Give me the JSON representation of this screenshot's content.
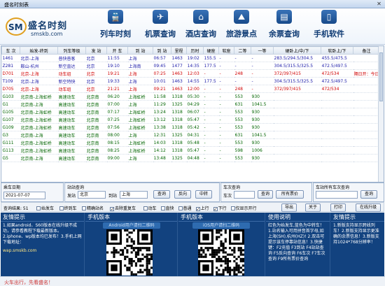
{
  "window": {
    "title": "盛名时刻表",
    "close_glyph": "✕"
  },
  "logo": {
    "mark": "SM",
    "name": "盛名时刻",
    "url": "smskb.com"
  },
  "nav": [
    {
      "label": "列车时刻",
      "icon": "train-icon",
      "glyph": "🚆"
    },
    {
      "label": "机票查询",
      "icon": "plane-icon",
      "glyph": "✈"
    },
    {
      "label": "酒店查询",
      "icon": "hotel-icon",
      "glyph": "⌂"
    },
    {
      "label": "旅游景点",
      "icon": "scenery-icon",
      "glyph": "⛰"
    },
    {
      "label": "余票查询",
      "icon": "ticket-icon",
      "glyph": "▤"
    },
    {
      "label": "手机软件",
      "icon": "phone-icon",
      "glyph": "▯"
    }
  ],
  "table": {
    "headers": [
      "车 次",
      "始发-终到",
      "列车等级",
      "发 站",
      "开 车",
      "到 站",
      "到 站",
      "里程",
      "历时",
      "硬座",
      "软座",
      "二等",
      "一等",
      "硬卧上/中/下",
      "软卧上/下",
      "备注"
    ],
    "rows": [
      {
        "style": "blue",
        "cells": [
          "1461",
          "北京-上海",
          "普快普客",
          "北京",
          "11:55",
          "上海",
          "06:57",
          "1463",
          "19:02",
          "155.5",
          "-",
          "-",
          "-",
          "283.5/294.5/304.5",
          "455.5/475.5",
          ""
        ]
      },
      {
        "style": "blue",
        "cells": [
          "Z281",
          "鞍山-杭州",
          "新空直达",
          "北京",
          "19:10",
          "上海南",
          "09:45",
          "1477",
          "14:35",
          "177.5",
          "-",
          "-",
          "-",
          "304.5/315.5/325.5",
          "472.5/497.5",
          ""
        ]
      },
      {
        "style": "red",
        "cells": [
          "D701",
          "北京-上海",
          "动车组",
          "北京",
          "19:21",
          "上海",
          "07:25",
          "1463",
          "12:03",
          "-",
          "-",
          "248",
          "-",
          "372/397/415",
          "472/534",
          "隔日开：今日开"
        ]
      },
      {
        "style": "blue",
        "cells": [
          "T109",
          "北京-上海",
          "新空特快",
          "北京",
          "19:33",
          "上海",
          "10:01",
          "1463",
          "14:55",
          "177.5",
          "-",
          "-",
          "-",
          "304.5/315.5/325.5",
          "472.5/497.5",
          ""
        ]
      },
      {
        "style": "red",
        "cells": [
          "D705",
          "北京-上海",
          "动车组",
          "北京",
          "21:21",
          "上海",
          "09:21",
          "1463",
          "12:00",
          "-",
          "-",
          "248",
          "-",
          "372/397/415",
          "472/534",
          ""
        ]
      },
      {
        "style": "green",
        "cells": [
          "G103",
          "北京南-上海虹桥",
          "高速动车",
          "北京南",
          "06:20",
          "上海虹桥",
          "11:58",
          "1318",
          "05:30",
          "-",
          "-",
          "553",
          "930",
          "",
          "",
          ""
        ]
      },
      {
        "style": "green",
        "cells": [
          "G1",
          "北京南-上海",
          "高速动车",
          "北京南",
          "07:00",
          "上海",
          "11:29",
          "1325",
          "04:29",
          "-",
          "-",
          "631",
          "1041.5",
          "",
          "",
          ""
        ]
      },
      {
        "style": "green",
        "cells": [
          "G105",
          "北京南-上海虹桥",
          "高速动车",
          "北京南",
          "07:17",
          "上海虹桥",
          "13:24",
          "1318",
          "06:07",
          "-",
          "-",
          "553",
          "930",
          "",
          "",
          ""
        ]
      },
      {
        "style": "green",
        "cells": [
          "G107",
          "北京南-上海虹桥",
          "高速动车",
          "北京南",
          "07:25",
          "上海虹桥",
          "13:12",
          "1318",
          "05:47",
          "-",
          "-",
          "553",
          "930",
          "",
          "",
          ""
        ]
      },
      {
        "style": "green",
        "cells": [
          "G109",
          "北京南-上海虹桥",
          "高速动车",
          "北京南",
          "07:56",
          "上海虹桥",
          "13:38",
          "1318",
          "05:42",
          "-",
          "-",
          "553",
          "930",
          "",
          "",
          ""
        ]
      },
      {
        "style": "green",
        "cells": [
          "G3",
          "北京南-上海",
          "高速动车",
          "北京南",
          "08:00",
          "上海",
          "12:31",
          "1325",
          "04:31",
          "-",
          "-",
          "631",
          "1041.5",
          "",
          "",
          ""
        ]
      },
      {
        "style": "green",
        "cells": [
          "G111",
          "北京南-上海虹桥",
          "高速动车",
          "北京南",
          "08:15",
          "上海虹桥",
          "14:03",
          "1318",
          "05:48",
          "-",
          "-",
          "553",
          "930",
          "",
          "",
          ""
        ]
      },
      {
        "style": "green",
        "cells": [
          "G113",
          "北京南-上海虹桥",
          "高速动车",
          "北京南",
          "08:25",
          "上海虹桥",
          "14:12",
          "1318",
          "05:47",
          "-",
          "-",
          "598",
          "1006",
          "",
          "",
          ""
        ]
      },
      {
        "style": "green",
        "cells": [
          "G5",
          "北京南-上海",
          "高速动车",
          "北京南",
          "09:00",
          "上海",
          "13:48",
          "1325",
          "04:48",
          "-",
          "-",
          "553",
          "930",
          "",
          "",
          ""
        ]
      }
    ]
  },
  "query": {
    "date_label": "乘车日期",
    "date_value": "2021-07-07",
    "station_label": "站站查询",
    "from_label": "发站",
    "from_value": "北京",
    "to_label": "到站",
    "to_value": "上海",
    "query_btn": "查询",
    "back_btn": "反向",
    "transfer_btn": "中转",
    "train_label": "车次查询",
    "train_prefix": "车次",
    "train_query_btn": "查询",
    "all_stops_btn": "所有票价",
    "station_all_label": "车站所有车次查询",
    "station_query_btn": "查询"
  },
  "options": {
    "result_label": "查询结果: 51",
    "items": [
      {
        "label": "始发车",
        "checked": false
      },
      {
        "label": "终到车",
        "checked": false
      },
      {
        "label": "精确站名",
        "checked": false
      },
      {
        "label": "去除重复车",
        "checked": true
      },
      {
        "label": "动车",
        "checked": false
      },
      {
        "label": "直快",
        "checked": false
      },
      {
        "label": "普通",
        "checked": false
      },
      {
        "label": "上行",
        "checked": true
      },
      {
        "label": "下行",
        "checked": true
      },
      {
        "label": "仅显示开行",
        "checked": false
      }
    ],
    "check_mark": "✓",
    "export_btn": "导出",
    "about_btn": "关于",
    "print_btn": "打印",
    "update_btn": "在线升级"
  },
  "bottom": {
    "tip_title": "友情提示",
    "tip_text": "1.如果android、S60版本在线升级不成功，请参看教程下载最新版本。2.iphone、wp版本均已发布！3.手机上网下载地址：",
    "tip_url": "wap.smskb.com",
    "android_title": "手机版本",
    "android_qr_label": "Android用户请扫二维码",
    "ios_title": "手机版本",
    "ios_qr_label": "iOS用户请扫二维码",
    "usage_title": "使用说明",
    "usage_text": "红色为始发车,蓝色为中转车！1.站名输入可用拼音首字母,如上海(SH),杭州(HZ)! 2.双击可提示该车停靠站信息！3.快捷键：F2充值 F3到站 F4站站查询 F5反向查询 F6车次 F7车次查询 F9所有票价查询",
    "tip2_title": "友情提示",
    "tip2_text": "1.新版支持显示跨线列车！2.新版支持显示更准确的余票信息！3.新版支持1024*768分辨率！"
  },
  "status": {
    "text": "火车出行，先看盛名！"
  }
}
